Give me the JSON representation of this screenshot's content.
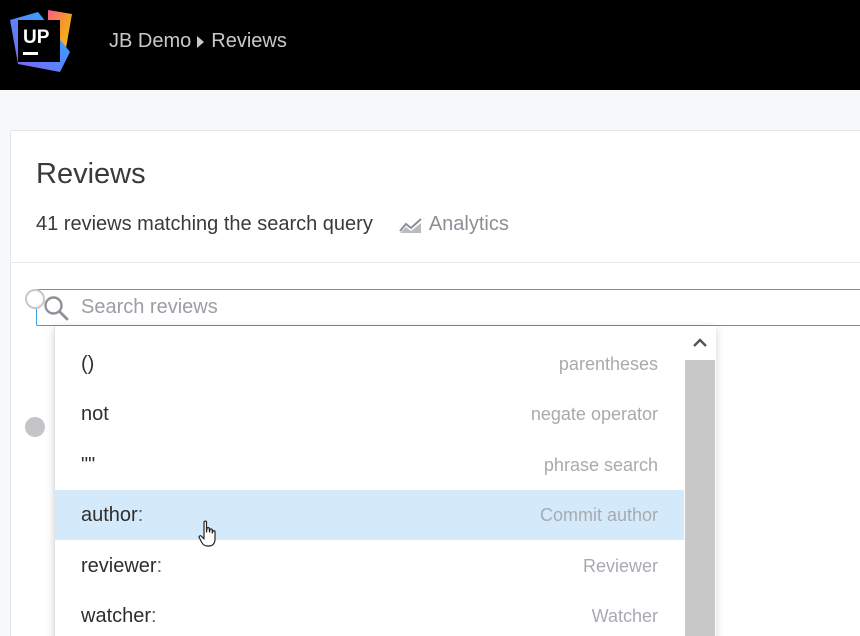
{
  "header": {
    "logo_text": "UP",
    "breadcrumb": {
      "project": "JB Demo",
      "page": "Reviews"
    }
  },
  "main": {
    "title": "Reviews",
    "summary": "41 reviews matching the search query",
    "analytics_label": "Analytics",
    "search": {
      "placeholder": "Search reviews",
      "value": ""
    }
  },
  "dropdown": {
    "items": [
      {
        "key": "()",
        "suffix": "",
        "desc": "parentheses"
      },
      {
        "key": "not",
        "suffix": "",
        "desc": "negate operator"
      },
      {
        "key": "\"\"",
        "suffix": "",
        "desc": "phrase search"
      },
      {
        "key": "author",
        "suffix": ":",
        "desc": "Commit author"
      },
      {
        "key": "reviewer",
        "suffix": ":",
        "desc": "Reviewer"
      },
      {
        "key": "watcher",
        "suffix": ":",
        "desc": "Watcher"
      }
    ]
  },
  "colors": {
    "topbar": "#000000",
    "accent": "#3a9fe6",
    "highlight": "#d4eafb"
  }
}
